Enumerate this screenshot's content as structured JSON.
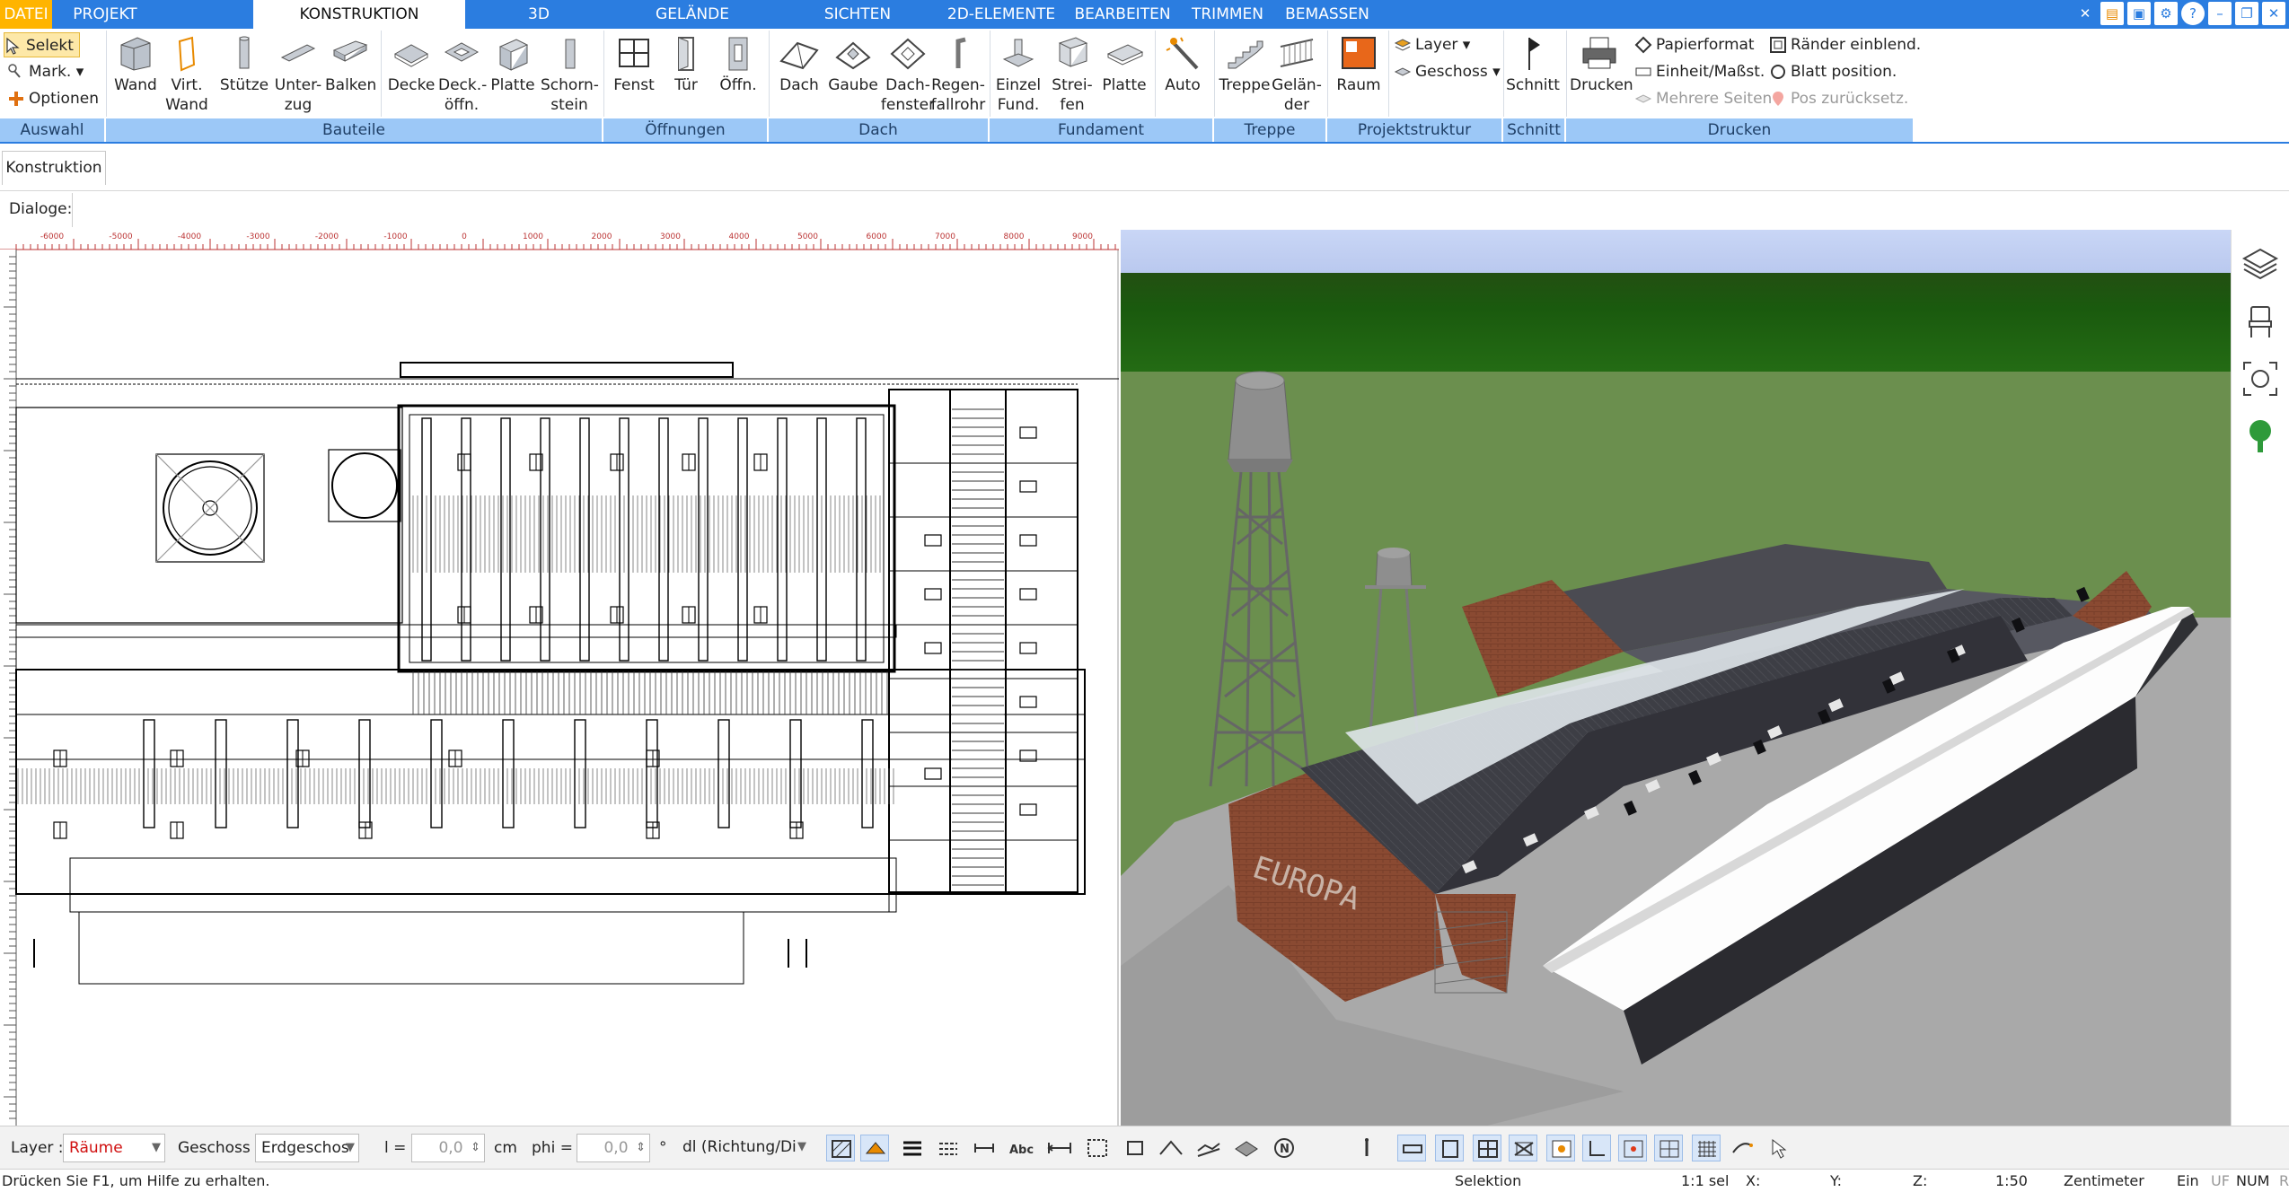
{
  "tabs": [
    {
      "label": "DATEI",
      "active": false
    },
    {
      "label": "PROJEKT",
      "active": false
    },
    {
      "label": "KONSTRUKTION",
      "active": true
    },
    {
      "label": "3D",
      "active": false
    },
    {
      "label": "GELÄNDE",
      "active": false
    },
    {
      "label": "SICHTEN",
      "active": false
    },
    {
      "label": "2D-ELEMENTE",
      "active": false
    },
    {
      "label": "BEARBEITEN",
      "active": false
    },
    {
      "label": "TRIMMEN",
      "active": false
    },
    {
      "label": "BEMASSEN",
      "active": false
    }
  ],
  "window_icons": [
    "tools-icon",
    "window-icon",
    "restore-layout-icon",
    "settings-icon",
    "help-icon",
    "minimize-icon",
    "maximize-icon",
    "close-icon"
  ],
  "ribbon": {
    "auswahl": {
      "selekt": "Selekt",
      "mark": "Mark.",
      "optionen": "Optionen",
      "group": "Auswahl"
    },
    "bauteile": {
      "wand": "Wand",
      "virt_l1": "Virt.",
      "virt_l2": "Wand",
      "stuetze": "Stütze",
      "unterzug_l1": "Unter-",
      "unterzug_l2": "zug",
      "balken": "Balken",
      "decke": "Decke",
      "deckoeffn_l1": "Deck.-",
      "deckoeffn_l2": "öffn.",
      "platte": "Platte",
      "schorn_l1": "Schorn-",
      "schorn_l2": "stein",
      "group": "Bauteile"
    },
    "oeffnungen": {
      "fenst": "Fenst",
      "tuer": "Tür",
      "oeffn": "Öffn.",
      "group": "Öffnungen"
    },
    "dach": {
      "dach": "Dach",
      "gaube": "Gaube",
      "dachfenster_l1": "Dach-",
      "dachfenster_l2": "fenster",
      "regen_l1": "Regen-",
      "regen_l2": "fallrohr",
      "group": "Dach"
    },
    "fundament": {
      "einzel_l1": "Einzel",
      "einzel_l2": "Fund.",
      "streifen_l1": "Strei-",
      "streifen_l2": "fen",
      "platte": "Platte",
      "auto": "Auto",
      "group": "Fundament"
    },
    "treppe": {
      "treppe": "Treppe",
      "gelaender_l1": "Gelän-",
      "gelaender_l2": "der",
      "group": "Treppe"
    },
    "projektstruktur": {
      "raum": "Raum",
      "layer": "Layer",
      "geschoss": "Geschoss",
      "group": "Projektstruktur"
    },
    "schnitt": {
      "schnitt": "Schnitt",
      "group": "Schnitt"
    },
    "drucken": {
      "drucken": "Drucken",
      "papierformat": "Papierformat",
      "einheit": "Einheit/Maßst.",
      "mehrere": "Mehrere Seiten",
      "raender": "Ränder einblend.",
      "blatt": "Blatt position.",
      "pos": "Pos zurücksetz.",
      "group": "Drucken"
    }
  },
  "konstruktion_button": "Konstruktion",
  "dialoge_label": "Dialoge:",
  "ruler_labels": [
    "-6000",
    "-5000",
    "-4000",
    "-3000",
    "-2000",
    "-1000",
    "0",
    "1000",
    "2000",
    "3000",
    "4000",
    "5000",
    "6000",
    "7000",
    "8000",
    "9000"
  ],
  "bottom": {
    "layer_label": "Layer :",
    "layer_value": "Räume",
    "layer_color": "#d01010",
    "geschoss_label": "Geschoss :",
    "geschoss_value": "Erdgeschos",
    "l_label": "l =",
    "l_value": "0,0",
    "l_unit": "cm",
    "phi_label": "phi =",
    "phi_value": "0,0",
    "phi_unit": "°",
    "dl_value": "dl (Richtung/Di"
  },
  "status": {
    "hint": "Drücken Sie F1, um Hilfe zu erhalten.",
    "mode": "Selektion",
    "sel": "1:1 sel",
    "x": "X:",
    "y": "Y:",
    "z": "Z:",
    "scale": "1:50",
    "unit": "Zentimeter",
    "ein": "Ein",
    "uf": "UF",
    "num": "NUM",
    "r": "R"
  },
  "colors": {
    "accent": "#2b7de0",
    "file_tab": "#ffb400",
    "group_bg": "#9cc8f7",
    "grass": "#6b8f4e",
    "forest": "#1e5a10",
    "sky": "#c5d3f2",
    "brick": "#8a4a32",
    "roof": "#3e3e44"
  },
  "building_text": "EUROPA"
}
